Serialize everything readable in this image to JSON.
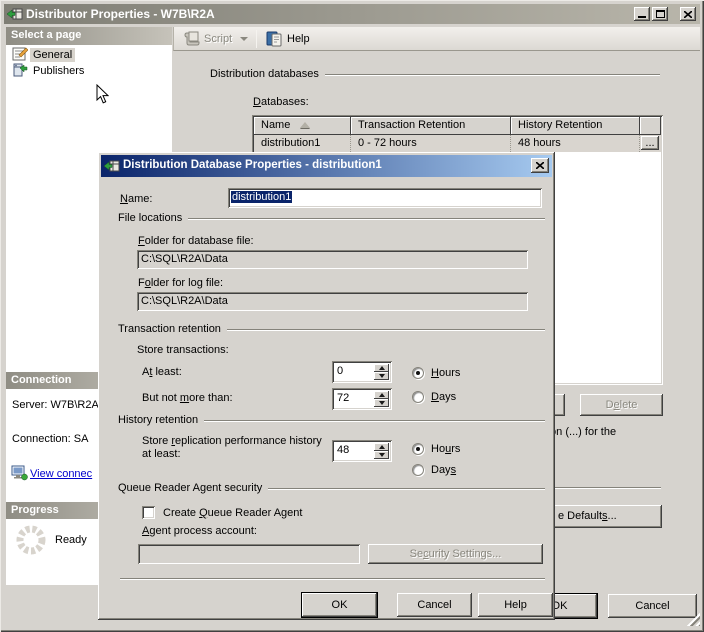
{
  "window": {
    "title": "Distributor Properties - W7B\\R2A"
  },
  "sidebar": {
    "select_page": {
      "header": "Select a page",
      "items": [
        {
          "label": "General"
        },
        {
          "label": "Publishers"
        }
      ]
    },
    "connection": {
      "header": "Connection",
      "server": "Server: W7B\\R2A",
      "connection": "Connection: SA",
      "link": "View connec"
    },
    "progress": {
      "header": "Progress",
      "status": "Ready"
    }
  },
  "toolbar": {
    "script_label": "Script",
    "help_label": "Help"
  },
  "main": {
    "group_title": "Distribution databases",
    "databases_label": "&Databases:",
    "table": {
      "columns": [
        "Name",
        "Transaction Retention",
        "History Retention"
      ],
      "row": {
        "name": "distribution1",
        "transaction_retention": "0 - 72 hours",
        "history_retention": "48 hours",
        "browse": "..."
      }
    },
    "delete_button": "D&elete",
    "hint_fragment": "ton (...) for the",
    "defaults_button": "e Default&s...",
    "ok_button": "OK",
    "cancel_button": "Cancel"
  },
  "modal": {
    "title": "Distribution Database Properties - distribution1",
    "name_label": "&Name:",
    "name_value": "distribution1",
    "file_locations": {
      "title": "File locations",
      "db_label": "&Folder for database file:",
      "db_value": "C:\\SQL\\R2A\\Data",
      "log_label": "F&older for log file:",
      "log_value": "C:\\SQL\\R2A\\Data"
    },
    "transaction_retention": {
      "title": "Transaction retention",
      "store_label": "Store transactions:",
      "at_least_label": "A&t least:",
      "at_least_value": "0",
      "not_more_label": "But not &more than:",
      "not_more_value": "72",
      "hours_label": "&Hours",
      "days_label": "&Days",
      "selected_unit": "Hours"
    },
    "history_retention": {
      "title": "History retention",
      "store_label": "Store &replication performance history at least:",
      "value": "48",
      "hours_label": "Ho&urs",
      "days_label": "Day&s",
      "selected_unit": "Hours"
    },
    "queue_security": {
      "title": "Queue Reader Agent security",
      "checkbox_label": "Create &Queue Reader Agent",
      "checkbox_checked": false,
      "account_label": "&Agent process account:",
      "account_value": "",
      "security_button": "Se&curity Settings..."
    },
    "buttons": {
      "ok": "OK",
      "cancel": "Cancel",
      "help": "Help"
    }
  }
}
